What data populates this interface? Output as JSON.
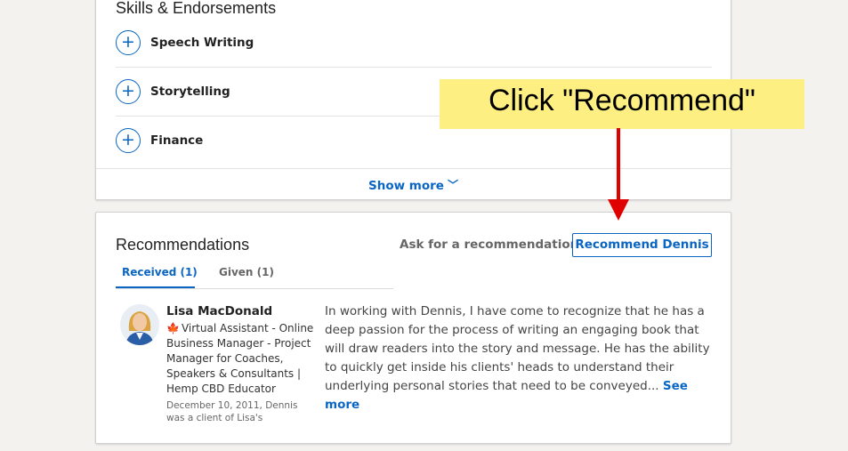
{
  "skills": {
    "title": "Skills & Endorsements",
    "items": [
      {
        "name": "Speech Writing"
      },
      {
        "name": "Storytelling"
      },
      {
        "name": "Finance"
      }
    ],
    "show_more_label": "Show more",
    "chevron_icon": "chevron-down-icon"
  },
  "recommendations": {
    "title": "Recommendations",
    "ask_label": "Ask for a recommendation",
    "recommend_button_label": "Recommend Dennis",
    "tabs": [
      {
        "label": "Received (1)",
        "active": true
      },
      {
        "label": "Given (1)",
        "active": false
      }
    ],
    "entry": {
      "name": "Lisa MacDonald",
      "headline_icon": "maple-leaf-icon",
      "headline": "Virtual Assistant - Online Business Manager - Project Manager for Coaches, Speakers & Consultants | Hemp CBD Educator",
      "date": "December 10, 2011, Dennis was a client of Lisa's",
      "text": "In working with Dennis, I have come to recognize that he has a deep passion for the process of writing an engaging book that will draw readers into the story and message. He has the ability to quickly get inside his clients' heads to understand their underlying personal stories that need to be conveyed...",
      "see_more_label": "See more"
    }
  },
  "callout": {
    "text": "Click \"Recommend\"",
    "background": "#fdef82",
    "arrow_color": "#e00000"
  },
  "colors": {
    "accent": "#0a66c2",
    "page_bg": "#f3f2ef"
  }
}
